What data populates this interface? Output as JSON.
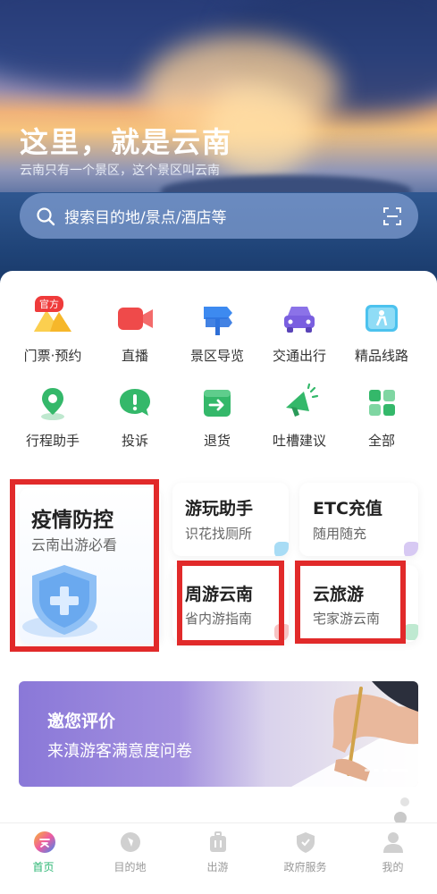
{
  "hero": {
    "title": "这里，就是云南",
    "subtitle": "云南只有一个景区，这个景区叫云南",
    "search_placeholder": "搜索目的地/景点/酒店等"
  },
  "services": [
    {
      "label": "门票·预约",
      "icon": "ticket-mountain-icon",
      "badge": "官方"
    },
    {
      "label": "直播",
      "icon": "live-camera-icon"
    },
    {
      "label": "景区导览",
      "icon": "signpost-icon"
    },
    {
      "label": "交通出行",
      "icon": "car-icon"
    },
    {
      "label": "精品线路",
      "icon": "route-hiker-icon"
    },
    {
      "label": "行程助手",
      "icon": "location-pin-icon"
    },
    {
      "label": "投诉",
      "icon": "exclamation-bubble-icon"
    },
    {
      "label": "退货",
      "icon": "return-arrow-icon"
    },
    {
      "label": "吐槽建议",
      "icon": "megaphone-icon"
    },
    {
      "label": "全部",
      "icon": "grid-apps-icon"
    }
  ],
  "features": {
    "epidemic": {
      "title": "疫情防控",
      "subtitle": "云南出游必看"
    },
    "assistant": {
      "title": "游玩助手",
      "subtitle": "识花找厕所"
    },
    "etc": {
      "title": "ETC充值",
      "subtitle": "随用随充"
    },
    "weekend": {
      "title": "周游云南",
      "subtitle": "省内游指南"
    },
    "cloud_tour": {
      "title": "云旅游",
      "subtitle": "宅家游云南"
    }
  },
  "banner": {
    "title": "邀您评价",
    "subtitle": "来滇游客满意度问卷"
  },
  "tabbar": [
    {
      "label": "首页",
      "icon": "home-icon",
      "active": true
    },
    {
      "label": "目的地",
      "icon": "destination-icon",
      "active": false
    },
    {
      "label": "出游",
      "icon": "luggage-icon",
      "active": false
    },
    {
      "label": "政府服务",
      "icon": "shield-icon",
      "active": false
    },
    {
      "label": "我的",
      "icon": "user-icon",
      "active": false
    }
  ],
  "colors": {
    "accent_green": "#2bb673",
    "highlight_red": "#e12a2a",
    "badge_red": "#ef3b3b"
  }
}
